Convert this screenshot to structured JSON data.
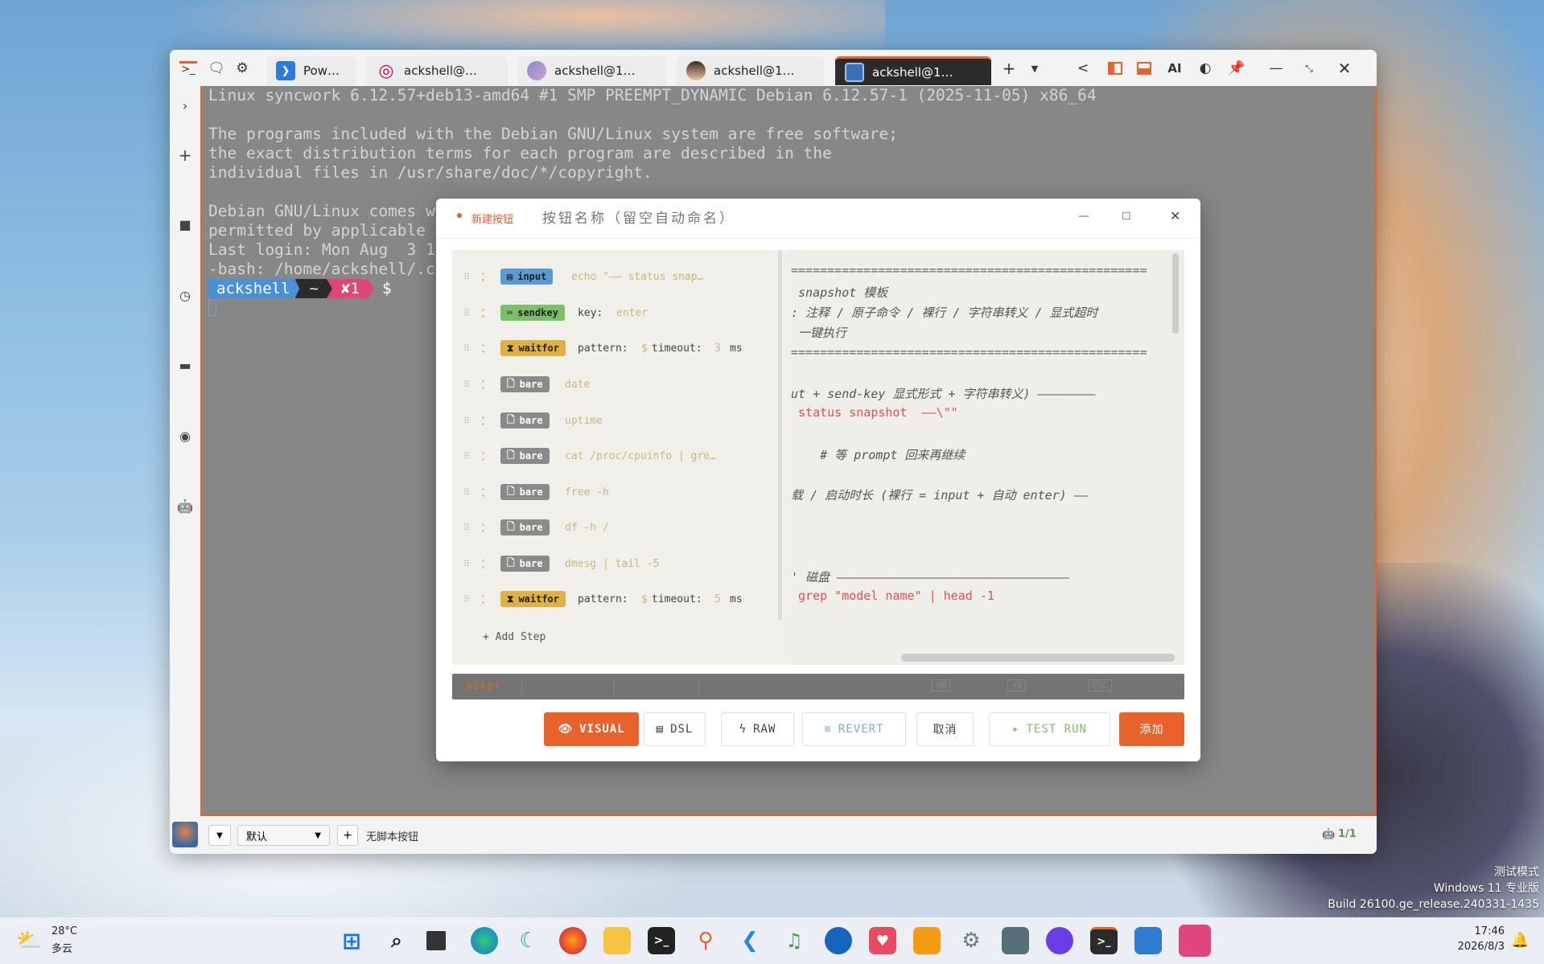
{
  "window": {
    "tabs": [
      {
        "label": "Pow…",
        "active": false
      },
      {
        "label": "ackshell@…",
        "active": false
      },
      {
        "label": "ackshell@1…",
        "active": false
      },
      {
        "label": "ackshell@1…",
        "active": false
      },
      {
        "label": "ackshell@1…",
        "active": true
      }
    ],
    "toolbar": {
      "ai_label": "AI"
    }
  },
  "terminal": {
    "lines": [
      "Linux syncwork 6.12.57+deb13-amd64 #1 SMP PREEMPT_DYNAMIC Debian 6.12.57-1 (2025-11-05) x86_64",
      "",
      "The programs included with the Debian GNU/Linux system are free software;",
      "the exact distribution terms for each program are described in the",
      "individual files in /usr/share/doc/*/copyright.",
      "",
      "Debian GNU/Linux comes w",
      "permitted by applicable",
      "Last login: Mon Aug  3 1",
      "-bash: /home/ackshell/.c"
    ],
    "prompt": {
      "user": "ackshell",
      "dir": "~",
      "status": "✘1",
      "symbol": "$"
    }
  },
  "bottombar": {
    "profile_select": "默认",
    "no_script_label": "无脚本按钮",
    "page_indicator": "1/1"
  },
  "dialog": {
    "tag": "新建按钮",
    "name_placeholder": "按钮名称（留空自动命名）",
    "steps": [
      {
        "type": "input",
        "text": "echo \"—— status snap…",
        "color": "#5b9bd5"
      },
      {
        "type": "sendkey",
        "label_key": "key:",
        "value": "enter",
        "color": "#7bbf6a"
      },
      {
        "type": "waitfor",
        "label_pattern": "pattern:",
        "pattern_value": "$",
        "label_timeout": "timeout:",
        "timeout_value": "3",
        "unit": "ms",
        "color": "#e0b040"
      },
      {
        "type": "bare",
        "text": "date",
        "color": "#8a8a8a"
      },
      {
        "type": "bare",
        "text": "uptime",
        "color": "#8a8a8a"
      },
      {
        "type": "bare",
        "text": "cat /proc/cpuinfo | gre…",
        "color": "#8a8a8a"
      },
      {
        "type": "bare",
        "text": "free -h",
        "color": "#8a8a8a"
      },
      {
        "type": "bare",
        "text": "df -h /",
        "color": "#8a8a8a"
      },
      {
        "type": "bare",
        "text": "dmesg | tail -5",
        "color": "#8a8a8a"
      },
      {
        "type": "waitfor",
        "label_pattern": "pattern:",
        "pattern_value": "$",
        "label_timeout": "timeout:",
        "timeout_value": "5",
        "unit": "ms",
        "color": "#e0b040"
      }
    ],
    "add_step": "+ Add Step",
    "code_lines": [
      "=================================================",
      " snapshot 模板",
      ": 注释 / 原子命令 / 裸行 / 字符串转义 / 显式超时",
      " 一键执行",
      "=================================================",
      "",
      "ut + send-key 显式形式 + 字符串转义) ————————",
      " status snapshot  ——\\\"\"",
      "",
      "    # 等 prompt 回来再继续",
      "",
      "载 / 启动时长 (裸行 = input + 自动 enter) ——",
      "",
      "",
      "' 磁盘 ————————————————————————————————",
      " grep \"model name\" | head -1"
    ],
    "status": {
      "state": "READY",
      "keys": [
        "⌘R",
        "⌘S",
        "ESC"
      ]
    },
    "buttons": {
      "visual": "VISUAL",
      "dsl": "DSL",
      "raw": "RAW",
      "revert": "REVERT",
      "cancel": "取消",
      "test_run": "TEST RUN",
      "add": "添加"
    }
  },
  "desktop": {
    "watermark": [
      "测试模式",
      "Windows 11 专业版",
      "Build 26100.ge_release.240331-1435"
    ]
  },
  "taskbar": {
    "weather_temp": "28°C",
    "weather_desc": "多云",
    "time": "17:46",
    "date": "2026/8/3"
  },
  "colors": {
    "accent": "#e8622c",
    "terminal_bg": "#878787",
    "prompt_user": "#4a90d9",
    "prompt_status": "#e0457b"
  }
}
